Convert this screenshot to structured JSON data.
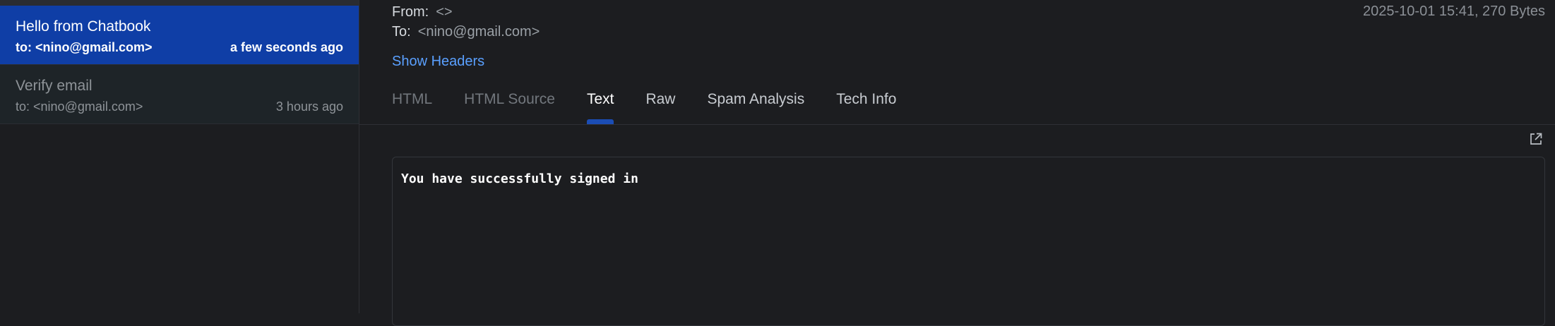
{
  "messages": [
    {
      "subject": "Hello from Chatbook",
      "to": "to: <nino@gmail.com>",
      "time": "a few seconds ago",
      "active": true
    },
    {
      "subject": "Verify email",
      "to": "to: <nino@gmail.com>",
      "time": "3 hours ago",
      "active": false
    }
  ],
  "header": {
    "from_label": "From:",
    "from_value": "<>",
    "to_label": "To:",
    "to_value": "<nino@gmail.com>",
    "meta": "2025-10-01 15:41, 270 Bytes",
    "show_headers": "Show Headers"
  },
  "tabs": [
    {
      "label": "HTML",
      "state": "muted"
    },
    {
      "label": "HTML Source",
      "state": "muted"
    },
    {
      "label": "Text",
      "state": "active"
    },
    {
      "label": "Raw",
      "state": "normal"
    },
    {
      "label": "Spam Analysis",
      "state": "normal"
    },
    {
      "label": "Tech Info",
      "state": "normal"
    }
  ],
  "body_text": "You have successfully signed in",
  "icons": {
    "popout": "external-link-icon"
  },
  "colors": {
    "accent": "#0f3ea6",
    "link": "#5aa0ff",
    "background": "#1c1d20"
  }
}
